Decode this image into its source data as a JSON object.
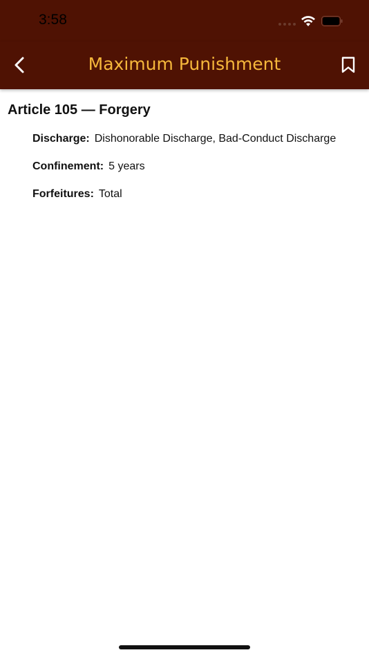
{
  "status_bar": {
    "time": "3:58",
    "wifi_icon": "wifi-icon",
    "battery_icon": "battery-icon"
  },
  "nav_bar": {
    "title": "Maximum Punishment",
    "back_icon": "chevron-left-icon",
    "bookmark_icon": "bookmark-icon",
    "title_color": "#f6b73b",
    "background_color": "#4f1203"
  },
  "article": {
    "title": "Article 105 — Forgery",
    "details": [
      {
        "label": "Discharge:",
        "value": "Dishonorable Discharge, Bad-Conduct Discharge"
      },
      {
        "label": "Confinement:",
        "value": "5 years"
      },
      {
        "label": "Forfeitures:",
        "value": "Total"
      }
    ]
  }
}
